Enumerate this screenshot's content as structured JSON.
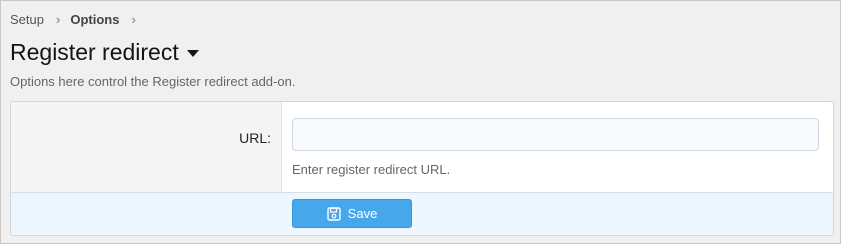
{
  "breadcrumb": {
    "items": [
      "Setup",
      "Options"
    ],
    "separator": "›"
  },
  "page": {
    "title": "Register redirect",
    "description": "Options here control the Register redirect add-on."
  },
  "form": {
    "url_label": "URL:",
    "url_value": "",
    "url_placeholder": "",
    "url_hint": "Enter register redirect URL."
  },
  "footer": {
    "save_label": "Save"
  },
  "icons": {
    "title_caret": "caret-down-icon",
    "save": "floppy-disk-icon"
  },
  "colors": {
    "accent": "#47a7eb",
    "footer_bg": "#edf5fd"
  }
}
